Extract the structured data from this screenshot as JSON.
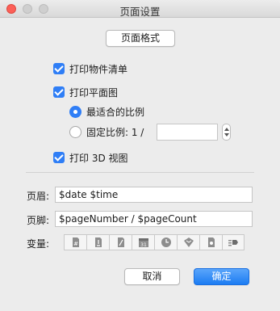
{
  "window": {
    "title": "页面设置"
  },
  "page_format_button": "页面格式",
  "options": {
    "print_item_list": "打印物件清单",
    "print_plan": "打印平面图",
    "best_fit_scale": "最适合的比例",
    "fixed_scale_label": "固定比例: 1 /",
    "fixed_scale_value": "",
    "print_3d_view": "打印 3D 视图"
  },
  "header": {
    "label": "页眉:",
    "value": "$date $time"
  },
  "footer": {
    "label": "页脚:",
    "value": "$pageNumber / $pageCount"
  },
  "variables": {
    "label": "变量:",
    "icons": [
      "page-number-icon",
      "page-count-icon",
      "plan-scale-icon",
      "date-icon",
      "time-icon",
      "plan-icon",
      "document-icon",
      "camera-icon"
    ]
  },
  "buttons": {
    "cancel": "取消",
    "ok": "确定"
  },
  "colors": {
    "accent": "#2f7ef6",
    "close": "#fc5f57"
  }
}
